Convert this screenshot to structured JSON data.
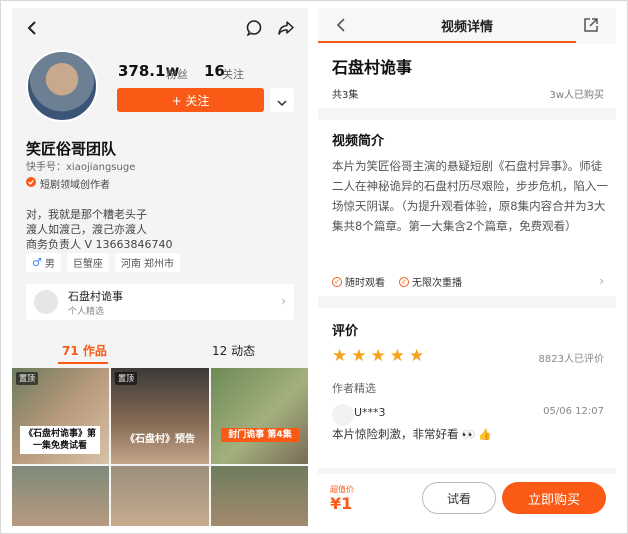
{
  "colors": {
    "accent": "#fa5a16",
    "star": "#f7a21b"
  },
  "profile": {
    "followers_count": "378.1w",
    "followers_label": "粉丝",
    "following_count": "16",
    "following_label": "关注",
    "follow_button": "+ 关注",
    "name": "笑匠俗哥团队",
    "handle": "快手号：xiaojiangsuge",
    "creator_badge": "短剧领域创作者",
    "bio": [
      "对，我就是那个糟老头子",
      "渡人如渡己，渡己亦渡人",
      "商务负责人 V 13663846740"
    ],
    "tags": {
      "gender": "男",
      "zodiac": "巨蟹座",
      "location": "河南 郑州市"
    }
  },
  "collection": {
    "title": "石盘村诡事",
    "subtitle": "个人精选"
  },
  "tabs": {
    "works": "71 作品",
    "moments": "12 动态"
  },
  "grid": [
    {
      "pinned": "置顶",
      "caption": "《石盘村诡事》第一集免费试看"
    },
    {
      "pinned": "置顶",
      "caption": "《石盘村》预告"
    },
    {
      "pinned": "",
      "caption": "封门诡事 第4集"
    },
    {
      "pinned": "",
      "caption": ""
    },
    {
      "pinned": "",
      "caption": ""
    },
    {
      "pinned": "",
      "caption": ""
    }
  ],
  "detail": {
    "header_title": "视频详情",
    "title": "石盘村诡事",
    "episodes": "共3集",
    "bought": "3w人已购买",
    "intro_title": "视频简介",
    "intro_text": "本片为笑匠俗哥主演的悬疑短剧《石盘村异事》。师徒二人在神秘诡异的石盘村历尽艰险，步步危机，陷入一场惊天阴谋。（为提升观看体验，原8集内容合并为3大集共8个篇章。第一大集含2个篇章，免费观看）",
    "perk1": "随时观看",
    "perk2": "无限次重播",
    "eval_title": "评价",
    "eval_count": "8823人已评价",
    "picks_title": "作者精选",
    "comment_user": "U***3",
    "comment_date": "05/06 12:07",
    "comment_text": "本片惊险刺激，非常好看",
    "price_label": "超值价",
    "price": "¥1",
    "try_button": "试看",
    "buy_button": "立即购买"
  }
}
